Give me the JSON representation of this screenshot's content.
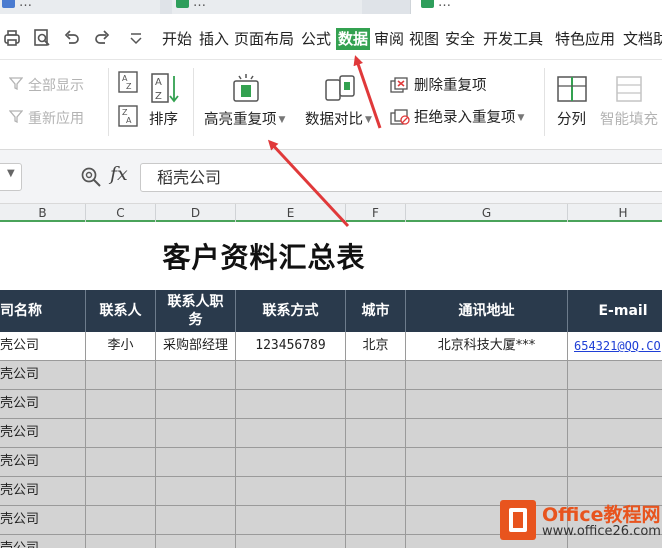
{
  "tabs": [
    {
      "label": "…",
      "icon": "sheet-tab-icon",
      "color": "#4a7bd0"
    },
    {
      "label": "…",
      "icon": "sheet-tab-icon",
      "color": "#2e9e5b"
    },
    {
      "label": "…",
      "icon": "sheet-tab-icon",
      "color": "#2e9e5b"
    }
  ],
  "quick_access": {
    "icons": [
      "print-icon",
      "print-preview-icon",
      "undo-icon",
      "redo-icon",
      "customize-dropdown-icon"
    ]
  },
  "menu": {
    "items": [
      "开始",
      "插入",
      "页面布局",
      "公式",
      "数据",
      "审阅",
      "视图",
      "安全",
      "开发工具",
      "特色应用",
      "文档助"
    ],
    "active_index": 4,
    "active_color": "#33a150"
  },
  "ribbon": {
    "show_all": "全部显示",
    "reapply": "重新应用",
    "sort": "排序",
    "highlight_duplicates": "高亮重复项",
    "data_compare": "数据对比",
    "remove_duplicates": "删除重复项",
    "reject_duplicates": "拒绝录入重复项",
    "text_to_columns": "分列",
    "smart_fill": "智能填充"
  },
  "formula_bar": {
    "fx": "fx",
    "value": "稻壳公司"
  },
  "columns": [
    "B",
    "C",
    "D",
    "E",
    "F",
    "G",
    "H"
  ],
  "sheet": {
    "title": "客户资料汇总表",
    "headers": [
      "司名称",
      "联系人",
      "联系人职务",
      "联系方式",
      "城市",
      "通讯地址",
      "E-mail"
    ],
    "first_row": {
      "company": "壳公司",
      "contact": "李小",
      "position": "采购部经理",
      "phone": "123456789",
      "city": "北京",
      "address": "北京科技大厦***",
      "email": "654321@QQ.CO"
    },
    "company_col": [
      "壳公司",
      "壳公司",
      "壳公司",
      "壳公司",
      "壳公司",
      "壳公司",
      "壳公司"
    ]
  },
  "watermark": {
    "title": "Office教程网",
    "url": "www.office26.com",
    "color": "#e8541e"
  },
  "accent_colors": {
    "header_bg": "#2a3a4c",
    "cell_gray": "#d3d3d3",
    "arrow_red": "#e0393a"
  }
}
